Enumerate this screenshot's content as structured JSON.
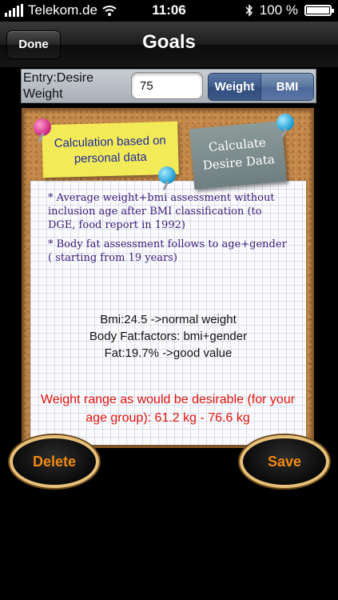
{
  "status_bar": {
    "carrier": "Telekom.de",
    "time": "11:06",
    "battery": "100 %"
  },
  "nav": {
    "done_label": "Done",
    "title": "Goals"
  },
  "entry": {
    "label": "Entry:Desire Weight",
    "value": "75",
    "segments": [
      "Weight",
      "BMI"
    ],
    "selected_segment": "Weight"
  },
  "notes": {
    "yellow": "Calculation based on personal data",
    "grey": "Calculate Desire Data"
  },
  "info": {
    "bullet1": "* Average weight+bmi assessment without inclusion age after BMI classification (to DGE, food report in 1992)",
    "bullet2": "* Body fat assessment follows to age+gender ( starting from 19 years)"
  },
  "results": {
    "bmi": "Bmi:24.5 ->normal weight",
    "body_fat_factors": "Body Fat:factors: bmi+gender",
    "fat": "Fat:19.7% ->good value"
  },
  "warning": "Weight range as would be desirable (for your age group): 61.2 kg - 76.6 kg",
  "actions": {
    "delete_label": "Delete",
    "save_label": "Save"
  },
  "colors": {
    "warning": "#e0140c",
    "action_text": "#f08a0c",
    "segment_blue": "#3d5b8c"
  }
}
